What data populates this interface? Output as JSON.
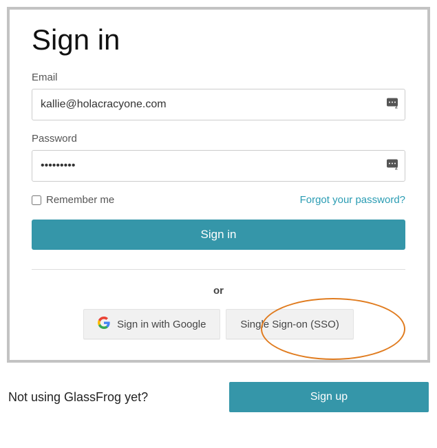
{
  "title": "Sign in",
  "email": {
    "label": "Email",
    "value": "kallie@holacracyone.com"
  },
  "password": {
    "label": "Password",
    "value": "•••••••••"
  },
  "remember_label": "Remember me",
  "forgot_label": "Forgot your password?",
  "signin_button": "Sign in",
  "or_label": "or",
  "google_button": "Sign in with Google",
  "sso_button": "Single Sign-on (SSO)",
  "footer_text": "Not using GlassFrog yet?",
  "signup_button": "Sign up"
}
